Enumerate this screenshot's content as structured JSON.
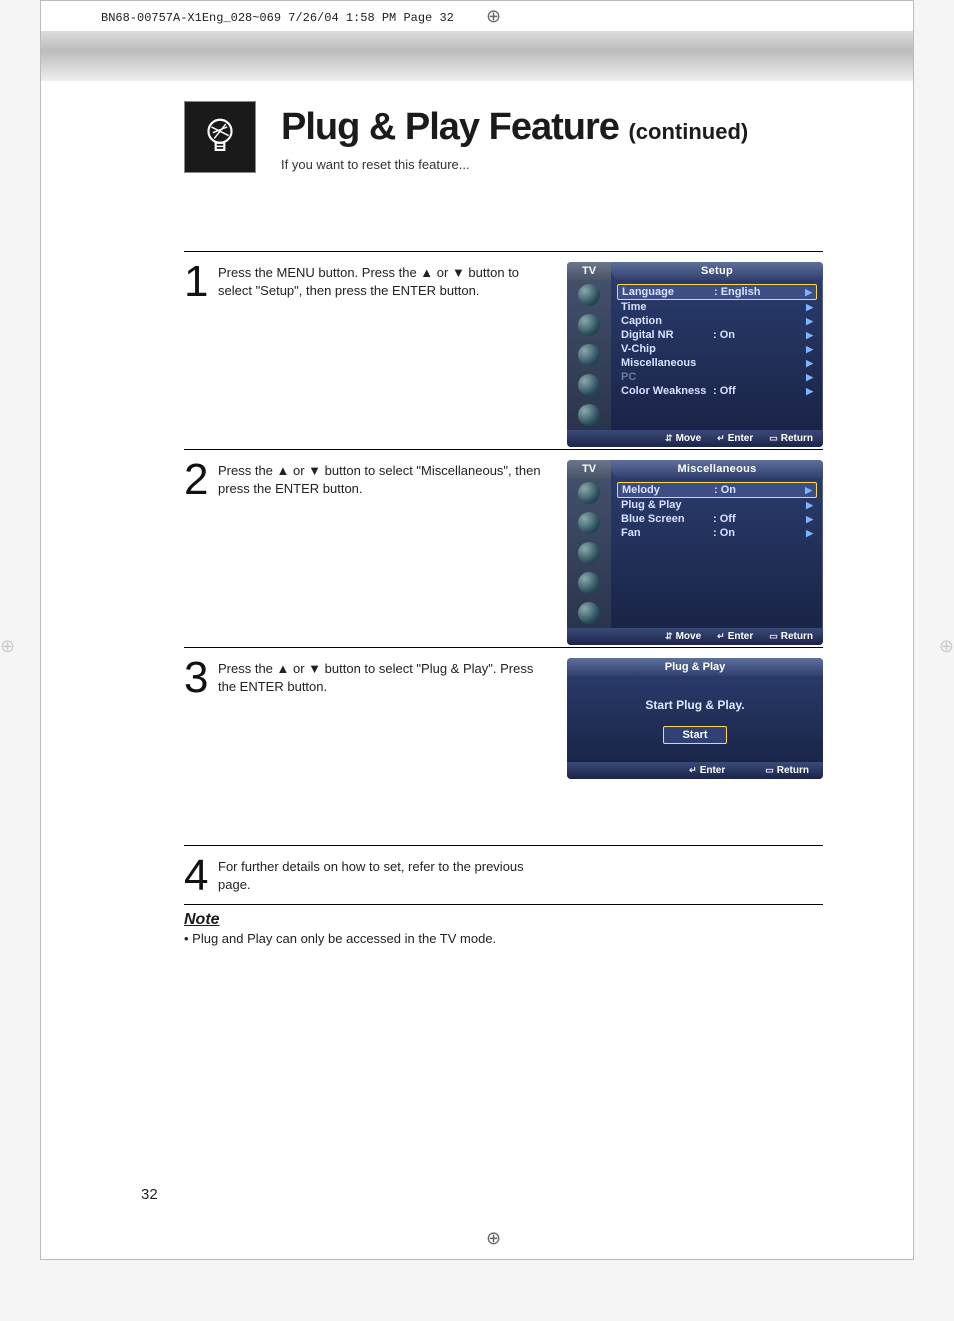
{
  "print_header": "BN68-00757A-X1Eng_028~069  7/26/04  1:58 PM  Page 32",
  "title": {
    "main": "Plug & Play Feature ",
    "sub": "(continued)",
    "tagline": "If you want to reset this feature..."
  },
  "steps": [
    {
      "num": "1",
      "text": "Press the MENU button. Press the ▲ or ▼ button to select \"Setup\", then press the ENTER button."
    },
    {
      "num": "2",
      "text": "Press the ▲ or ▼ button to select \"Miscellaneous\", then press the ENTER button."
    },
    {
      "num": "3",
      "text": "Press the ▲ or ▼ button to select \"Plug & Play\". Press the ENTER button."
    },
    {
      "num": "4",
      "text": "For further details on how to set, refer to the previous page."
    }
  ],
  "osd_setup": {
    "tv": "TV",
    "title": "Setup",
    "rows": [
      {
        "label": "Language",
        "value": ":  English",
        "selected": true
      },
      {
        "label": "Time",
        "value": "",
        "selected": false
      },
      {
        "label": "Caption",
        "value": "",
        "selected": false
      },
      {
        "label": "Digital NR",
        "value": ":  On",
        "selected": false
      },
      {
        "label": "V-Chip",
        "value": "",
        "selected": false
      },
      {
        "label": "Miscellaneous",
        "value": "",
        "selected": false
      },
      {
        "label": "PC",
        "value": "",
        "selected": false,
        "dim": true
      },
      {
        "label": "Color Weakness",
        "value": ":  Off",
        "selected": false
      }
    ],
    "footer": {
      "move": "Move",
      "enter": "Enter",
      "return": "Return"
    }
  },
  "osd_misc": {
    "tv": "TV",
    "title": "Miscellaneous",
    "rows": [
      {
        "label": "Melody",
        "value": ":  On",
        "selected": true
      },
      {
        "label": "Plug & Play",
        "value": "",
        "selected": false
      },
      {
        "label": "Blue Screen",
        "value": ":  Off",
        "selected": false
      },
      {
        "label": "Fan",
        "value": ":  On",
        "selected": false
      }
    ],
    "footer": {
      "move": "Move",
      "enter": "Enter",
      "return": "Return"
    }
  },
  "osd_pp": {
    "title": "Plug & Play",
    "message": "Start Plug & Play.",
    "button": "Start",
    "footer": {
      "enter": "Enter",
      "return": "Return"
    }
  },
  "note": {
    "title": "Note",
    "bullet": "•  Plug and Play can only be accessed in the TV mode."
  },
  "page_number": "32"
}
